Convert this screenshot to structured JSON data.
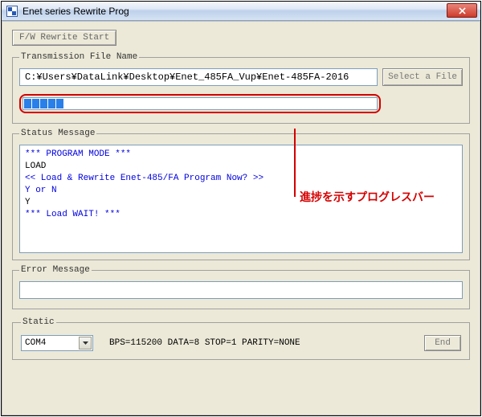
{
  "window": {
    "title": "Enet series Rewrite Prog"
  },
  "buttons": {
    "rewrite_start": "F/W Rewrite Start",
    "select_file": "Select a File",
    "end": "End"
  },
  "sections": {
    "transmission": "Transmission File Name",
    "status": "Status Message",
    "error": "Error Message",
    "static": "Static"
  },
  "file": {
    "path": "C:¥Users¥DataLink¥Desktop¥Enet_485FA_Vup¥Enet-485FA-2016"
  },
  "progress": {
    "chunks_visible": 5
  },
  "status_lines": [
    {
      "text": "*** PROGRAM MODE ***",
      "cls": "blue"
    },
    {
      "text": "LOAD",
      "cls": "black"
    },
    {
      "text": "<< Load & Rewrite Enet-485/FA Program Now? >>",
      "cls": "blue"
    },
    {
      "text": "Y or N",
      "cls": "blue"
    },
    {
      "text": "Y",
      "cls": "black"
    },
    {
      "text": "*** Load WAIT! ***",
      "cls": "blue"
    }
  ],
  "static_params": {
    "port": "COM4",
    "line": "BPS=115200  DATA=8  STOP=1  PARITY=NONE"
  },
  "annotation": {
    "label": "進捗を示すプログレスバー"
  }
}
